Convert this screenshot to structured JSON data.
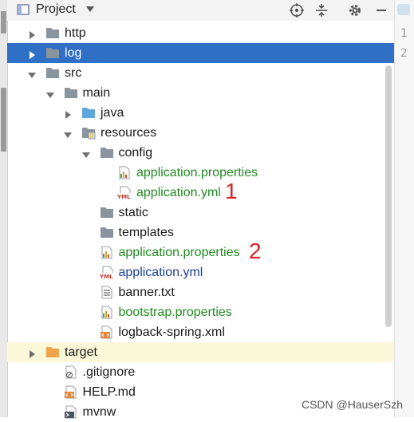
{
  "window": {
    "title": "Project",
    "line_numbers": [
      "1",
      "2"
    ]
  },
  "tree": [
    {
      "label": "http",
      "icon": "folder-icon",
      "arrow": "collapsed",
      "depth": 0,
      "color": "default"
    },
    {
      "label": "log",
      "icon": "folder-icon",
      "arrow": "collapsed",
      "depth": 0,
      "color": "selected",
      "selected": true
    },
    {
      "label": "src",
      "icon": "folder-icon",
      "arrow": "expanded",
      "depth": 0,
      "color": "default"
    },
    {
      "label": "main",
      "icon": "folder-icon",
      "arrow": "expanded",
      "depth": 1,
      "color": "default"
    },
    {
      "label": "java",
      "icon": "source-folder-icon",
      "arrow": "collapsed",
      "depth": 2,
      "color": "default"
    },
    {
      "label": "resources",
      "icon": "resources-folder-icon",
      "arrow": "expanded",
      "depth": 2,
      "color": "default"
    },
    {
      "label": "config",
      "icon": "folder-icon",
      "arrow": "expanded",
      "depth": 3,
      "color": "default"
    },
    {
      "label": "application.properties",
      "icon": "properties-file-icon",
      "arrow": "none",
      "depth": 4,
      "color": "green"
    },
    {
      "label": "application.yml",
      "icon": "yml-file-icon",
      "arrow": "none",
      "depth": 4,
      "color": "green"
    },
    {
      "label": "static",
      "icon": "folder-icon",
      "arrow": "none",
      "depth": 3,
      "color": "default"
    },
    {
      "label": "templates",
      "icon": "folder-icon",
      "arrow": "none",
      "depth": 3,
      "color": "default"
    },
    {
      "label": "application.properties",
      "icon": "properties-file-icon",
      "arrow": "none",
      "depth": 3,
      "color": "green"
    },
    {
      "label": "application.yml",
      "icon": "yml-file-icon",
      "arrow": "none",
      "depth": 3,
      "color": "blue"
    },
    {
      "label": "banner.txt",
      "icon": "text-file-icon",
      "arrow": "none",
      "depth": 3,
      "color": "default"
    },
    {
      "label": "bootstrap.properties",
      "icon": "properties-file-icon",
      "arrow": "none",
      "depth": 3,
      "color": "green"
    },
    {
      "label": "logback-spring.xml",
      "icon": "xml-file-icon",
      "arrow": "none",
      "depth": 3,
      "color": "default"
    },
    {
      "label": "target",
      "icon": "excluded-folder-icon",
      "arrow": "collapsed",
      "depth": 0,
      "color": "default",
      "excluded": true
    },
    {
      "label": ".gitignore",
      "icon": "gitignore-file-icon",
      "arrow": "none",
      "depth": 1,
      "color": "default"
    },
    {
      "label": "HELP.md",
      "icon": "markdown-file-icon",
      "arrow": "none",
      "depth": 1,
      "color": "default"
    },
    {
      "label": "mvnw",
      "icon": "script-file-icon",
      "arrow": "none",
      "depth": 1,
      "color": "default"
    }
  ],
  "annotations": [
    "1",
    "2"
  ],
  "watermark": "CSDN @HauserSzh",
  "colors": {
    "selection": "#2f6fc5",
    "green_text": "#1f8a1f",
    "blue_text": "#1c3f99",
    "annotation": "#e02020"
  }
}
